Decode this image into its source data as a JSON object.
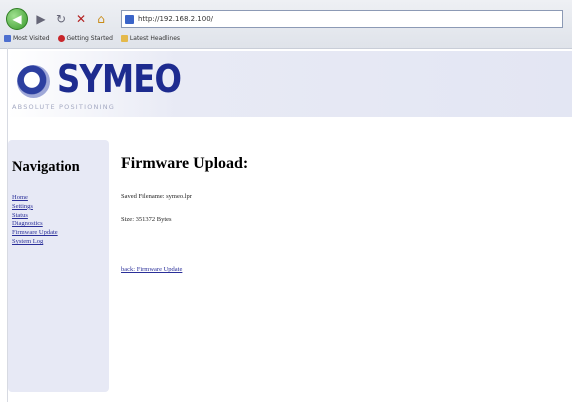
{
  "browser": {
    "back_glyph": "◀",
    "forward_glyph": "▶",
    "reload_glyph": "↻",
    "stop_glyph": "✕",
    "home_glyph": "⌂",
    "url": "http://192.168.2.100/",
    "bookmarks": [
      {
        "icon": "blue",
        "label": "Most Visited"
      },
      {
        "icon": "red",
        "label": "Getting Started"
      },
      {
        "icon": "folder",
        "label": "Latest Headlines"
      }
    ]
  },
  "header": {
    "logo_text": "SYMEO",
    "tagline": "ABSOLUTE POSITIONING"
  },
  "sidebar": {
    "title": "Navigation",
    "items": [
      {
        "label": "Home"
      },
      {
        "label": "Settings"
      },
      {
        "label": "Status"
      },
      {
        "label": "Diagnostics"
      },
      {
        "label": "Firmware Update"
      },
      {
        "label": "System Log"
      }
    ]
  },
  "main": {
    "title": "Firmware Upload:",
    "file_line": "Saved Filename: symeo.lpr",
    "size_line": "Size: 351372 Bytes",
    "back_link": "back: Firmware Update"
  },
  "colors": {
    "logo": "#1d2b8f",
    "link": "#2a2f99",
    "sidebar_bg": "#e7e9f5"
  }
}
